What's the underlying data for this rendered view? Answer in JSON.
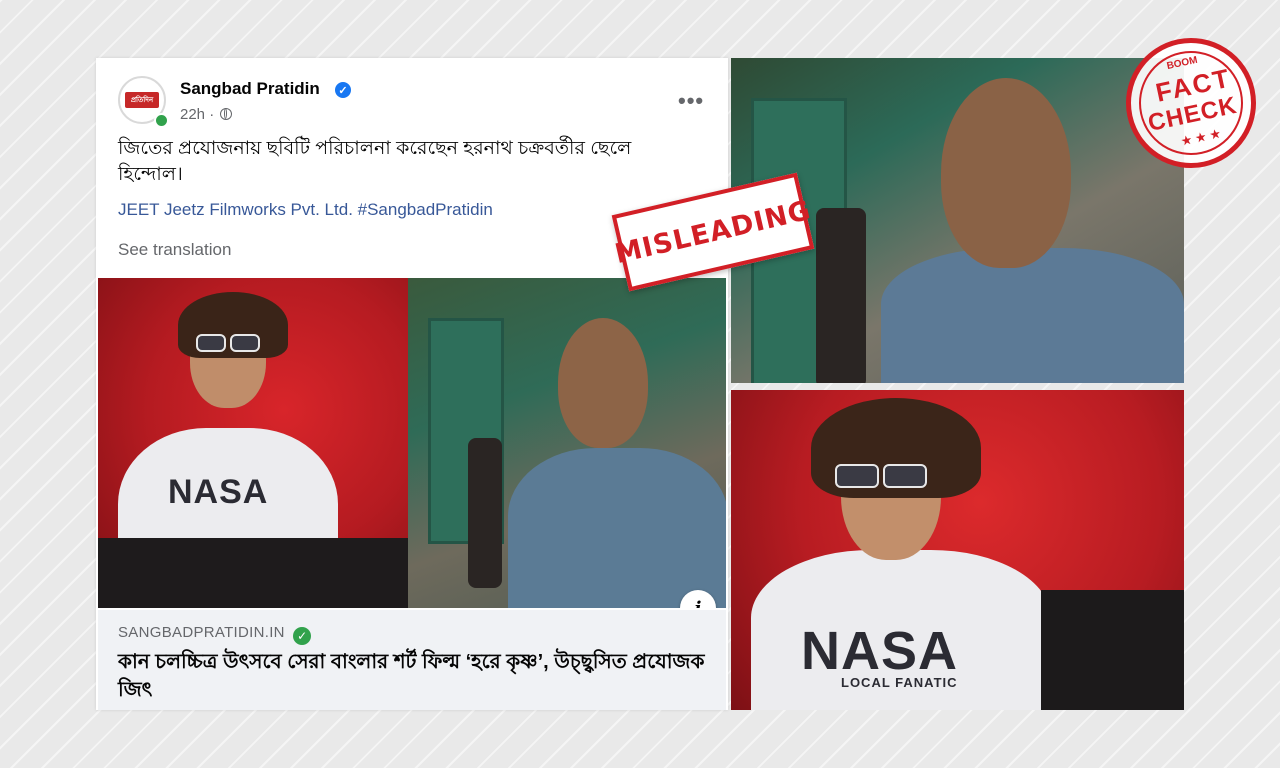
{
  "post": {
    "page_name": "Sangbad Pratidin",
    "avatar_logo": "প্রতিদিন",
    "time": "22h ·",
    "text": "জিতের প্রযোজনায় ছবিটি পরিচালনা করেছেন হরনাথ চক্রবর্তীর ছেলে হিন্দোল।",
    "hashtags": "JEET Jeetz Filmworks Pvt. Ltd. #SangbadPratidin",
    "see_translation": "See translation",
    "more": "•••",
    "info_icon": "i"
  },
  "link_preview": {
    "domain": "SANGBADPRATIDIN.IN",
    "title": "কান চলচ্চিত্র উৎসবে সেরা বাংলার শর্ট ফিল্ম ‘হরে কৃষ্ণ’, উচ্ছ্বসিত প্রযোজক জিৎ"
  },
  "stamps": {
    "misleading": "MISLEADING",
    "boom": "BOOM",
    "fact": "FACT",
    "check": "CHECK",
    "stars": "★★★"
  },
  "shirt_prints": {
    "nasa": "NASA",
    "sub": "LOCAL FANATIC"
  },
  "colors": {
    "stamp_red": "#d21f26",
    "facebook_blue": "#1877f2",
    "link_color": "#385898"
  },
  "icons": [
    "verified-badge-icon",
    "globe-icon",
    "more-options-icon",
    "info-icon",
    "domain-verified-check-icon"
  ]
}
